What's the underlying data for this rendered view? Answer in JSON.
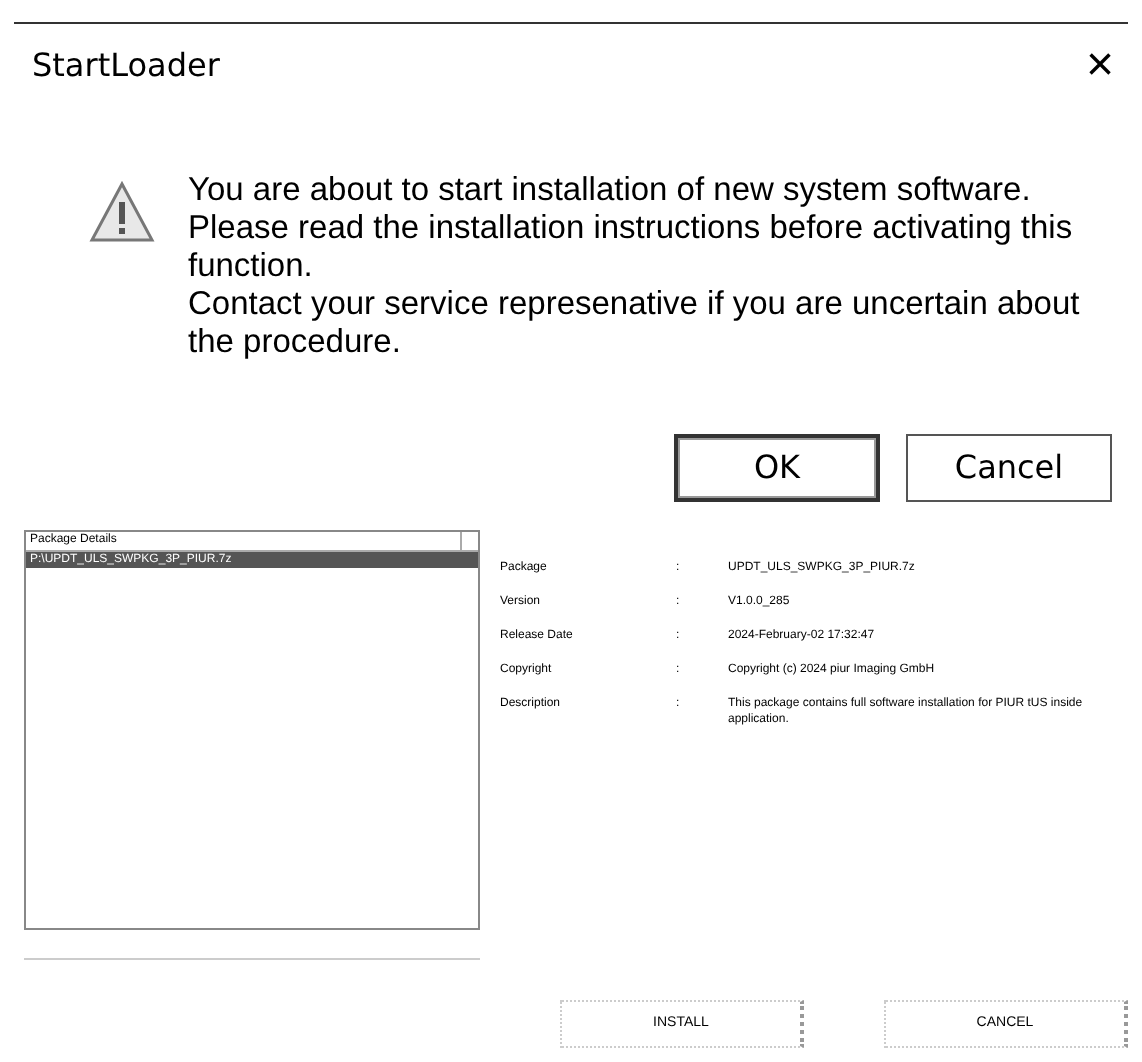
{
  "window": {
    "title": "StartLoader",
    "close": "×"
  },
  "message": [
    "You are about to start installation of new system software.",
    "Please read the installation instructions before activating this function.",
    "Contact your service represenative if you are uncertain about the procedure."
  ],
  "buttons": [
    {
      "label": "OK",
      "focused": true
    },
    {
      "label": "Cancel",
      "focused": false
    }
  ],
  "package_list": {
    "header": "Package Details",
    "items": [
      {
        "label": "P:\\UPDT_ULS_SWPKG_3P_PIUR.7z",
        "selected": true
      }
    ]
  },
  "details": [
    {
      "label": "Package",
      "separator": ":",
      "value": "UPDT_ULS_SWPKG_3P_PIUR.7z"
    },
    {
      "label": "Version",
      "separator": ":",
      "value": "V1.0.0_285"
    },
    {
      "label": "Release Date",
      "separator": ":",
      "value": "2024-February-02 17:32:47"
    },
    {
      "label": "Copyright",
      "separator": ":",
      "value": "Copyright (c) 2024 piur Imaging GmbH"
    },
    {
      "label": "Description",
      "separator": ":",
      "value": "This package contains full software installation for PIUR tUS inside application."
    }
  ],
  "footer_buttons": [
    "INSTALL",
    "CANCEL"
  ]
}
